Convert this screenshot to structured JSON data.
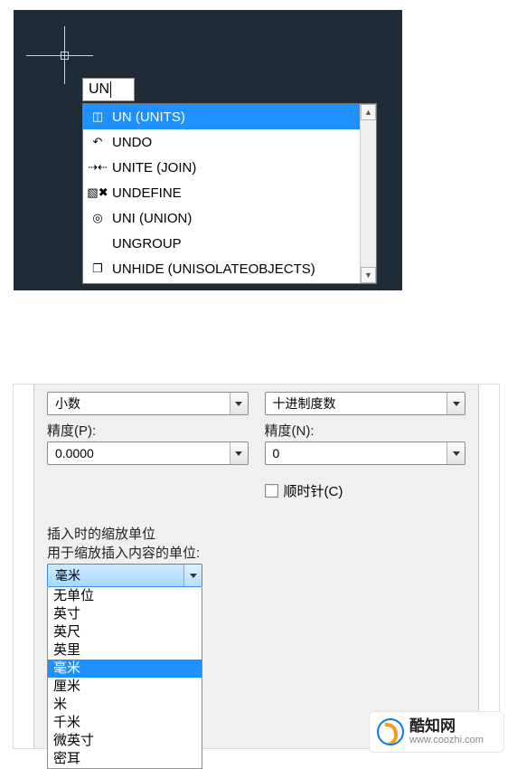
{
  "cad": {
    "input_value": "UN",
    "suggestions": [
      {
        "icon": "dim-icon",
        "glyph": "◫",
        "label": "UN (UNITS)",
        "selected": true
      },
      {
        "icon": "undo-icon",
        "glyph": "↶",
        "label": "UNDO"
      },
      {
        "icon": "join-icon",
        "glyph": "⇢⇠",
        "label": "UNITE (JOIN)"
      },
      {
        "icon": "undefine-icon",
        "glyph": "▧✖",
        "label": "UNDEFINE"
      },
      {
        "icon": "union-icon",
        "glyph": "◎",
        "label": "UNI (UNION)"
      },
      {
        "icon": "blank-icon",
        "glyph": "",
        "label": "UNGROUP"
      },
      {
        "icon": "unhide-icon",
        "glyph": "❐",
        "label": "UNHIDE (UNISOLATEOBJECTS)"
      }
    ]
  },
  "dialog": {
    "left": {
      "type_value": "小数",
      "precision_label": "精度(P):",
      "precision_value": "0.0000"
    },
    "right": {
      "type_value": "十进制度数",
      "precision_label": "精度(N):",
      "precision_value": "0",
      "clockwise_label": "顺时针(C)"
    },
    "insert": {
      "title": "插入时的缩放单位",
      "subtitle": "用于缩放插入内容的单位:",
      "selected": "毫米",
      "options": [
        {
          "label": "无单位"
        },
        {
          "label": "英寸"
        },
        {
          "label": "英尺"
        },
        {
          "label": "英里"
        },
        {
          "label": "毫米",
          "selected": true
        },
        {
          "label": "厘米"
        },
        {
          "label": "米"
        },
        {
          "label": "千米"
        },
        {
          "label": "微英寸"
        },
        {
          "label": "密耳"
        }
      ]
    }
  },
  "watermark": {
    "title": "酷知网",
    "url": "www.coozhi.com"
  }
}
